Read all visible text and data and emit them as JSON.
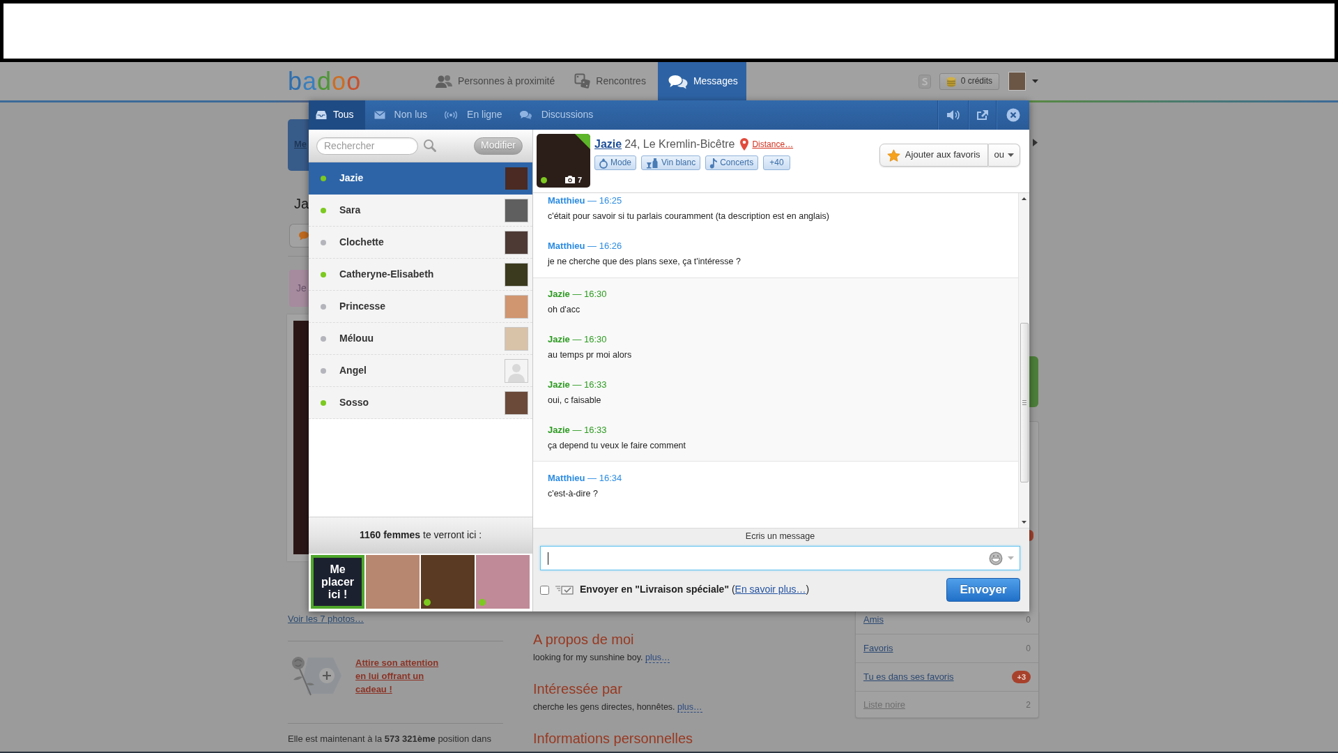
{
  "header": {
    "logo": "badoo",
    "nav": [
      {
        "label": "Personnes à proximité",
        "selected": false
      },
      {
        "label": "Rencontres",
        "selected": false
      },
      {
        "label": "Messages",
        "selected": true
      }
    ],
    "credits": "0 crédits"
  },
  "profile_page": {
    "side_tab": "Me",
    "name": "Ja",
    "note": "Je",
    "photos_link": "Voir les 7 photos…",
    "gift_link": "Attire son attention en lui offrant un cadeau !",
    "ranking": "Elle est maintenant à la **573 321ème** position dans",
    "sections": [
      {
        "title": "A propos de moi",
        "text": "looking for my sunshine boy.",
        "more": "plus…"
      },
      {
        "title": "Intéressée par",
        "text": "cherche les gens directes, honnêtes.",
        "more": "plus…"
      },
      {
        "title": "Informations personnelles"
      }
    ],
    "sidebar": [
      {
        "label": "Amis",
        "count": "0",
        "badge": false,
        "disabled": false
      },
      {
        "label": "Favoris",
        "count": "0",
        "badge": false,
        "disabled": false
      },
      {
        "label": "Tu es dans ses favoris",
        "count": "+3",
        "badge": true,
        "disabled": false
      },
      {
        "label": "Liste noire",
        "count": "2",
        "badge": false,
        "disabled": true
      }
    ]
  },
  "messenger": {
    "tabs": [
      {
        "label": "Tous",
        "selected": true
      },
      {
        "label": "Non lus",
        "selected": false
      },
      {
        "label": "En ligne",
        "selected": false
      },
      {
        "label": "Discussions",
        "selected": false
      }
    ],
    "search": {
      "placeholder": "Rechercher"
    },
    "edit_button": "Modifier",
    "contacts": [
      {
        "name": "Jazie",
        "online": true,
        "selected": true,
        "has_photo": true
      },
      {
        "name": "Sara",
        "online": true,
        "selected": false,
        "has_photo": true
      },
      {
        "name": "Clochette",
        "online": false,
        "selected": false,
        "has_photo": true
      },
      {
        "name": "Catheryne-Elisabeth",
        "online": true,
        "selected": false,
        "has_photo": true
      },
      {
        "name": "Princesse",
        "online": false,
        "selected": false,
        "has_photo": true
      },
      {
        "name": "Mélouu",
        "online": false,
        "selected": false,
        "has_photo": true
      },
      {
        "name": "Angel",
        "online": false,
        "selected": false,
        "has_photo": false
      },
      {
        "name": "Sosso",
        "online": true,
        "selected": false,
        "has_photo": true
      }
    ],
    "promo": {
      "text": "**1160 femmes** te verront ici :",
      "tiles": [
        {
          "kind": "cta",
          "label": "Me placer ici !",
          "online": false
        },
        {
          "kind": "photo",
          "online": false
        },
        {
          "kind": "photo",
          "online": true
        },
        {
          "kind": "photo",
          "online": true
        }
      ]
    },
    "profile": {
      "name": "Jazie",
      "details": "24, Le Kremlin-Bicêtre",
      "distance": "Distance…",
      "photo_count": "7",
      "online": true,
      "interests": [
        {
          "label": "Mode",
          "kind": "tag"
        },
        {
          "label": "Vin blanc",
          "kind": "tag"
        },
        {
          "label": "Concerts",
          "kind": "tag"
        },
        {
          "label": "+40",
          "kind": "more"
        }
      ],
      "favorite_button": "Ajouter aux favoris",
      "alt_button": "ou"
    },
    "conversation": [
      {
        "kind": "sent",
        "messages": [
          {
            "header": "**Matthieu** — 16:25",
            "text": "c'était pour savoir si tu parlais couramment (ta description est en anglais)"
          },
          {
            "header": "**Matthieu** — 16:26",
            "text": "je ne cherche que des plans sexe, ça t'intéresse ?"
          }
        ]
      },
      {
        "kind": "received",
        "messages": [
          {
            "header": "**Jazie** — 16:30",
            "text": "oh d'acc"
          },
          {
            "header": "**Jazie** — 16:30",
            "text": "au temps pr moi alors"
          },
          {
            "header": "**Jazie** — 16:33",
            "text": "oui, c faisable"
          },
          {
            "header": "**Jazie** — 16:33",
            "text": "ça depend tu veux le faire comment"
          }
        ]
      },
      {
        "kind": "sent",
        "messages": [
          {
            "header": "**Matthieu** — 16:34",
            "text": "c'est-à-dire ?"
          }
        ]
      }
    ],
    "compose": {
      "label": "Ecris un message",
      "focused": true,
      "special_delivery": {
        "checked": false,
        "text": "**Envoyer en \"Livraison spéciale\"** (",
        "link": "En savoir plus…",
        "text_after": ")"
      },
      "send_button": "Envoyer"
    }
  }
}
